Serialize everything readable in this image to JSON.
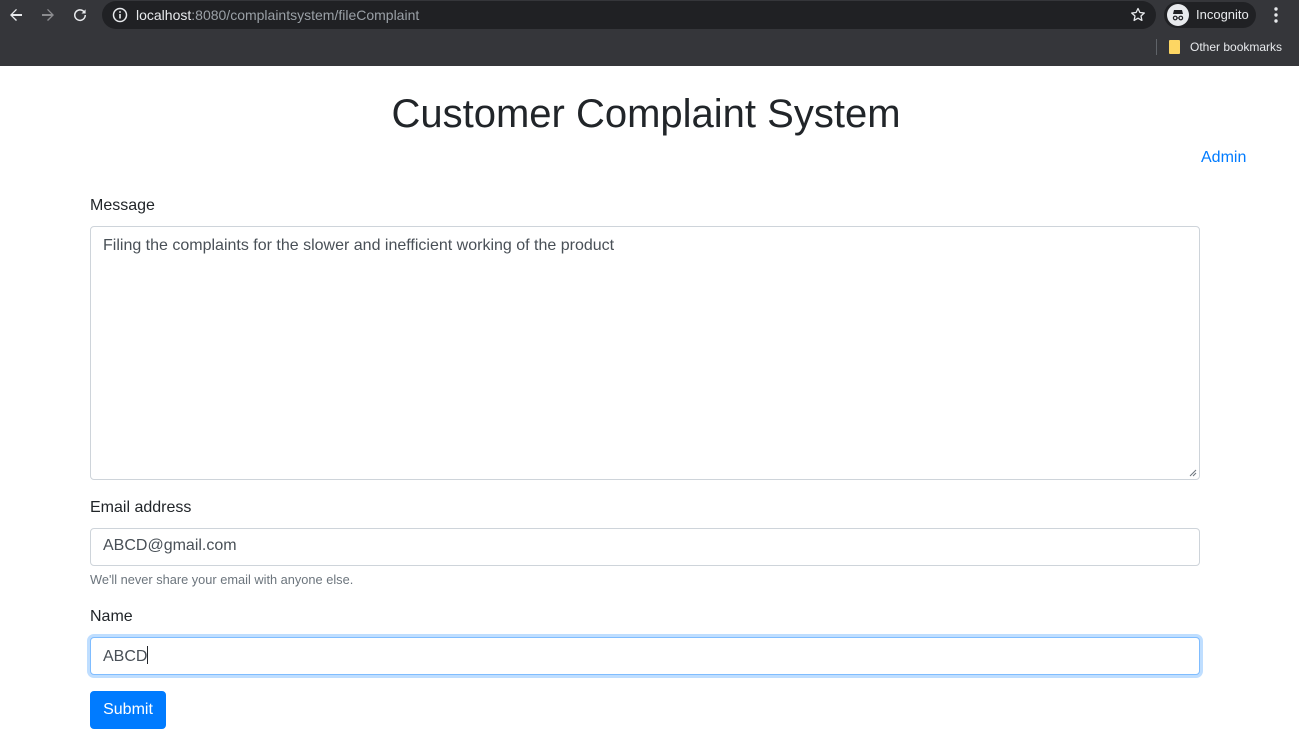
{
  "browser": {
    "url_host": "localhost",
    "url_rest": ":8080/complaintsystem/fileComplaint",
    "profile_label": "Incognito",
    "bookmarks": [
      "Other bookmarks"
    ],
    "icons": [
      "back-icon",
      "forward-icon",
      "reload-icon",
      "info-icon",
      "star-icon",
      "incognito-icon",
      "menu-icon",
      "folder-icon"
    ]
  },
  "page": {
    "title": "Customer Complaint System",
    "admin_link": "Admin"
  },
  "form": {
    "message_label": "Message",
    "message_value": "Filing the complaints for the slower and inefficient working of the product",
    "email_label": "Email address",
    "email_value": "ABCD@gmail.com",
    "email_help": "We'll never share your email with anyone else.",
    "name_label": "Name",
    "name_value": "ABCD",
    "submit_label": "Submit"
  },
  "colors": {
    "primary": "#007bff",
    "chrome_bg": "#35363a",
    "omnibox_bg": "#202124"
  }
}
